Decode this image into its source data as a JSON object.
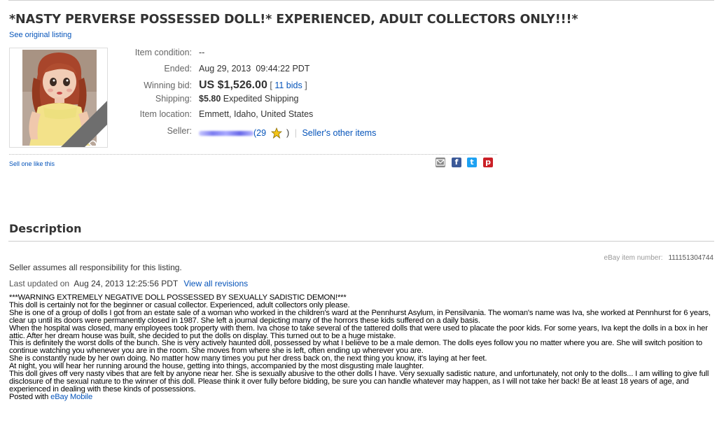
{
  "listing": {
    "title": "*NASTY PERVERSE POSSESSED DOLL!* EXPERIENCED, ADULT COLLECTORS ONLY!!!*",
    "see_original": "See original listing",
    "sold_badge": "SOLD",
    "details": [
      {
        "label": "Item condition:",
        "value": "--"
      },
      {
        "label": "Ended:",
        "value": "Aug 29, 2013  09:44:22 PDT"
      },
      {
        "label": "Winning bid:",
        "value": "US $1,526.00",
        "bids_open": "[",
        "bids_link": "11 bids",
        "bids_close": "]"
      },
      {
        "label": "Shipping:",
        "amount": "$5.80",
        "value": "Expedited Shipping"
      },
      {
        "label": "Item location:",
        "value": "Emmett, Idaho, United States"
      },
      {
        "label": "Seller:",
        "feedback": "(29",
        "feedback_close": ")",
        "separator": "|",
        "other_items": "Seller's other items"
      }
    ],
    "sell_one_like_this": "Sell one like this",
    "share_icons": [
      "email-icon",
      "facebook-icon",
      "twitter-icon",
      "pinterest-icon"
    ]
  },
  "description": {
    "heading": "Description",
    "item_number_label": "eBay item number:",
    "item_number": "111151304744",
    "seller_assumes": "Seller assumes all responsibility for this listing.",
    "last_updated_label": "Last updated on",
    "last_updated_value": "Aug 24, 2013 12:25:56 PDT",
    "view_revisions": "View all revisions",
    "paragraphs": [
      "***WARNING EXTREMELY NEGATIVE DOLL POSSESSED BY SEXUALLY SADISTIC DEMON!***",
      "This doll is certainly not for the beginner or casual collector. Experienced, adult collectors only please.",
      "She is one of a group of dolls I got from an estate sale of a woman who worked in the children's ward at the Pennhurst Asylum, in Pensilvania. The woman's name was Iva, she worked at Pennhurst for 6 years, clear up until its doors were permanently closed in 1987. She left a journal depicting many of the horrors these kids suffered on a daily basis.",
      "When the hospital was closed, many employees took property with them. Iva chose to take several of the tattered dolls that were used to placate the poor kids. For some years, Iva kept the dolls in a box in her attic. After her dream house was built, she decided to put the dolls on display. This turned out to be a huge mistake.",
      "This is definitely the worst dolls of the bunch. She is very actively haunted doll, possessed by what I believe to be a male demon. The dolls eyes follow you no matter where you are. She will switch position to continue watching you whenever you are in the room. She moves from where she is left, often ending up wherever you are.",
      "She is constantly nude by her own doing. No matter how many times you put her dress back on, the next thing you know, it's laying at her feet.",
      "At night, you will hear her running around the house, getting into things, accompanied by the most disgusting male laughter.",
      "This doll gives off very nasty vibes that are felt by anyone near her. She is sexually abusive to the other dolls I have. Very sexually sadistic nature, and unfortunately, not only to the dolls... I am willing to give full disclosure of the sexual nature to the winner of this doll. Please think it over fully before bidding, be sure you can handle whatever may happen, as I will not take her back! Be at least 18 years of age, and experienced in dealing with these kinds of possessions."
    ],
    "posted_with": "Posted with",
    "posted_link": "eBay Mobile"
  },
  "colors": {
    "link": "#0654ba",
    "star": "#f5c518",
    "facebook": "#3b5998",
    "twitter": "#1da1f2",
    "pinterest": "#cb2027",
    "email": "#888888",
    "sold_ribbon": "#6e6e6e"
  }
}
